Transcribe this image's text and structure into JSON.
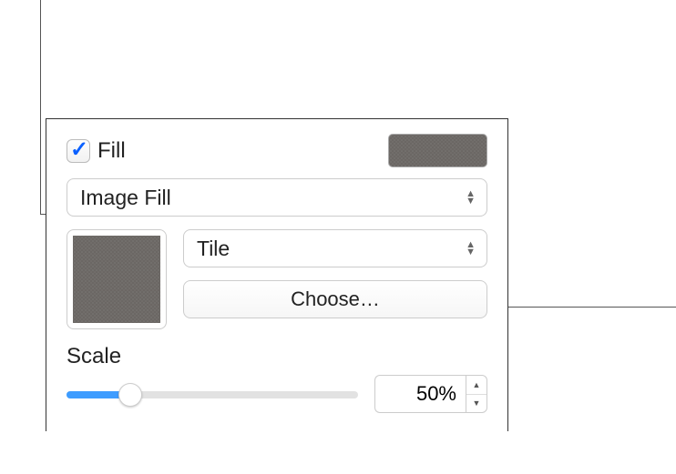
{
  "fill": {
    "checkbox_label": "Fill",
    "checked": true,
    "swatch_color": "#6b6764",
    "type_popup": "Image Fill",
    "tile_popup": "Tile",
    "choose_button": "Choose…",
    "scale": {
      "label": "Scale",
      "value": "50%",
      "percent": 50
    }
  }
}
